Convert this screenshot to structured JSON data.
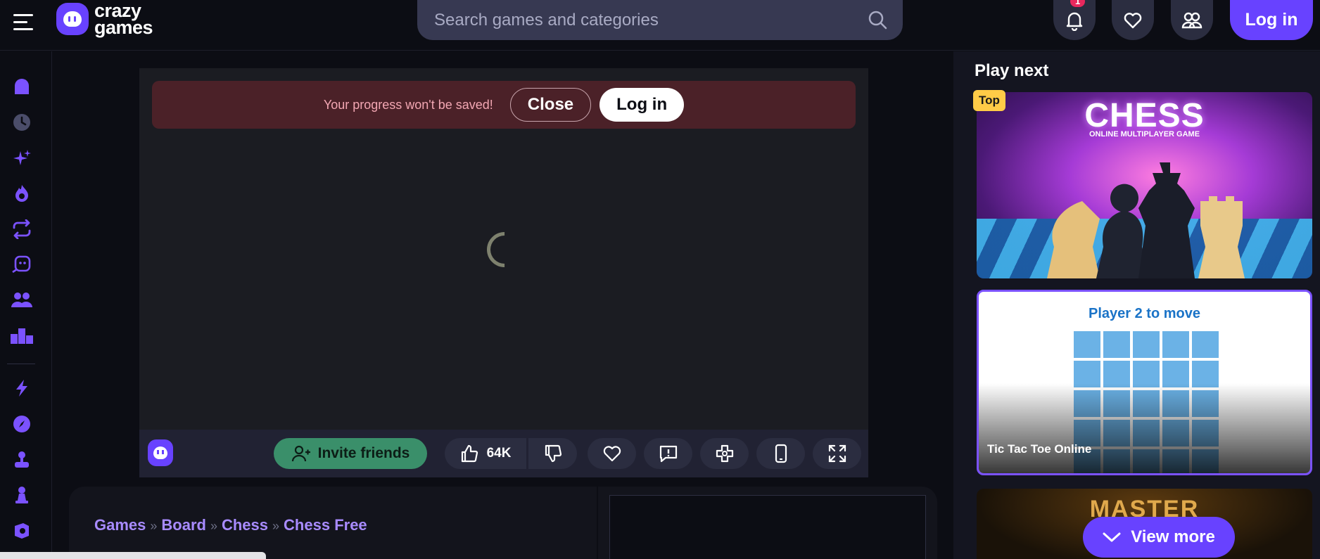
{
  "header": {
    "logo_line1": "crazy",
    "logo_line2": "games",
    "search_placeholder": "Search games and categories",
    "notification_count": "1",
    "login_label": "Log in"
  },
  "sidebar": {
    "items": [
      "home-icon",
      "recent-icon",
      "new-icon",
      "trending-icon",
      "updated-icon",
      "originals-icon",
      "multiplayer-icon",
      "leaderboard-icon",
      "action-icon",
      "adventure-icon",
      "arcade-icon",
      "board-icon",
      "casual-icon"
    ]
  },
  "game": {
    "warning_text": "Your progress won't be saved!",
    "close_label": "Close",
    "login_label": "Log in",
    "invite_label": "Invite friends",
    "like_count": "64K"
  },
  "breadcrumb": {
    "items": [
      "Games",
      "Board",
      "Chess",
      "Chess Free"
    ],
    "separator": "»"
  },
  "right_panel": {
    "title": "Play next",
    "cards": [
      {
        "tag": "Top",
        "art_title": "CHESS",
        "art_subtitle": "ONLINE MULTIPLAYER GAME"
      },
      {
        "label": "Tic Tac Toe Online",
        "art_title": "Player 2 to move"
      },
      {
        "art_title": "MASTER"
      }
    ],
    "view_more_label": "View more"
  },
  "colors": {
    "accent": "#6842ff",
    "background": "#0c0d14",
    "warning_bg": "#4b2128",
    "invite_green": "#3a8f6a"
  }
}
